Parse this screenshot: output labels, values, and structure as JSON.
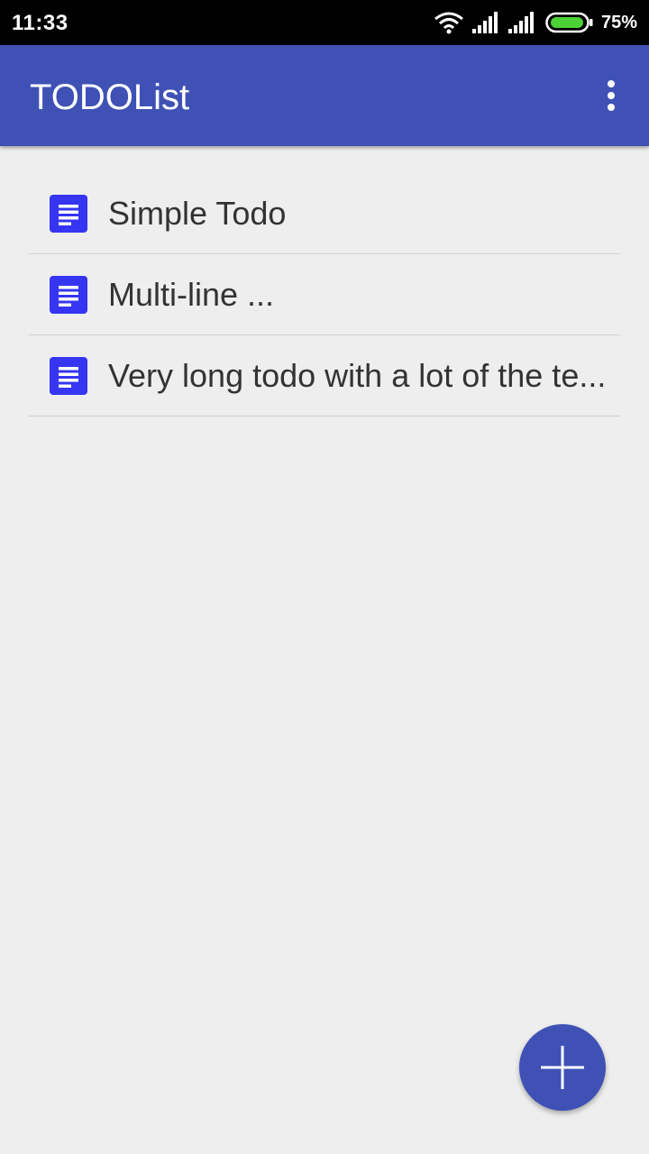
{
  "status_bar": {
    "time": "11:33",
    "battery_percent": "75%",
    "battery_level": 0.75,
    "battery_color": "#4cd137",
    "icons": [
      "wifi-icon",
      "signal-icon",
      "signal-icon",
      "battery-icon"
    ]
  },
  "app_bar": {
    "title": "TODOList",
    "color": "#3f51b5",
    "menu_icon": "more-vert-icon"
  },
  "todos": [
    {
      "label": "Simple Todo",
      "icon": "document-icon"
    },
    {
      "label": "Multi-line ...",
      "icon": "document-icon"
    },
    {
      "label": "Very long todo with a lot of the te...",
      "icon": "document-icon"
    }
  ],
  "todo_icon_color": "#3535f2",
  "fab": {
    "icon": "plus-icon",
    "color": "#3f51b5"
  }
}
